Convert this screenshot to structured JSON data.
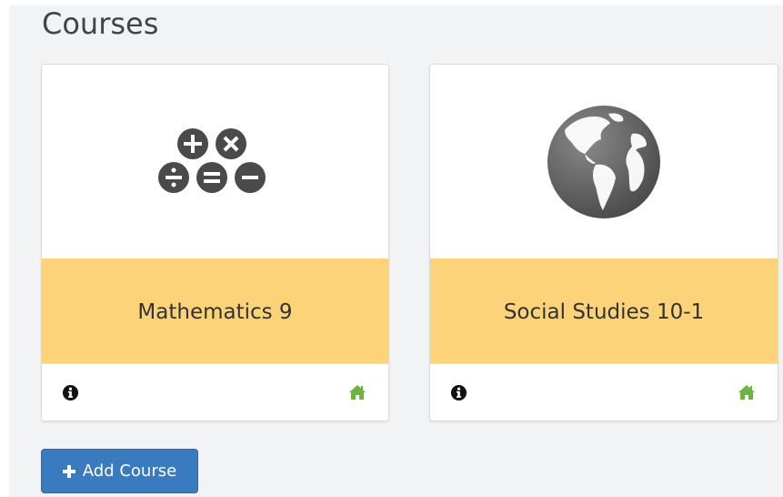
{
  "page": {
    "title": "Courses"
  },
  "courses": [
    {
      "title": "Mathematics 9",
      "image_icon": "math-operators-icon",
      "footer_icons": [
        "info-icon",
        "home-icon"
      ]
    },
    {
      "title": "Social Studies 10-1",
      "image_icon": "globe-icon",
      "footer_icons": [
        "info-icon",
        "home-icon"
      ]
    }
  ],
  "actions": {
    "add_course_label": "Add Course"
  },
  "colors": {
    "background": "#f1f3f5",
    "card_title_band": "#fdd37a",
    "primary_button": "#3a7bbf",
    "home_icon": "#6db33f",
    "icon_dark": "#4a4a4a"
  }
}
